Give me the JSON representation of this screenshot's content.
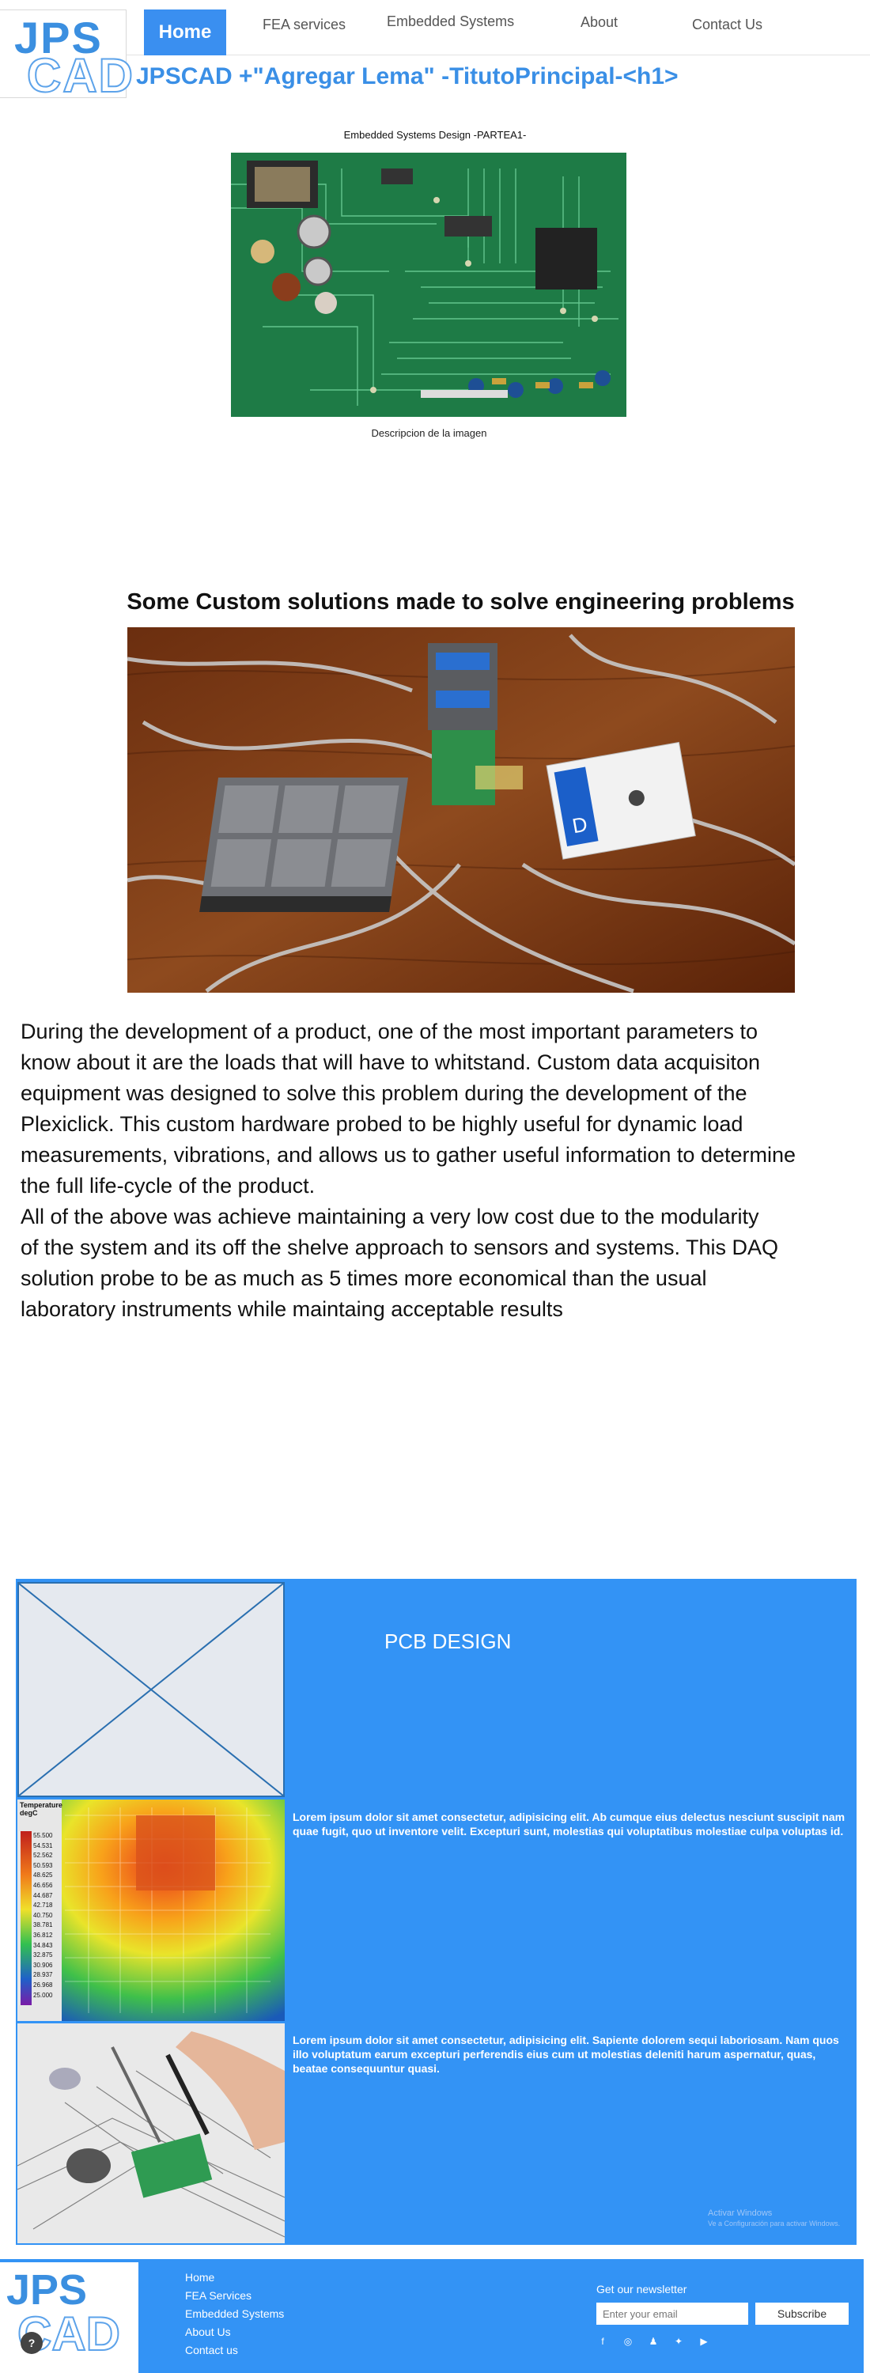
{
  "header": {
    "logo_top": "JPS",
    "logo_bottom": "CAD",
    "nav": [
      "Home",
      "FEA services",
      "Embedded Systems",
      "About",
      "Contact Us"
    ],
    "site_title": "JPSCAD +\"Agregar Lema\" -TitutoPrincipal-<h1>"
  },
  "figure1": {
    "title": "Embedded Systems Design -PARTEA1-",
    "caption": "Descripcion de la imagen"
  },
  "section2": {
    "title": "Some Custom solutions made to solve engineering problems",
    "paragraph1": "During the development of a product, one of the most important parameters to\nknow about it are the loads that will have to whitstand. Custom data acquisiton\nequipment was designed to solve this problem during the development of the\nPlexiclick. This custom hardware probed to be highly useful for dynamic load\nmeasurements, vibrations, and allows us to gather useful information to determine\nthe full life-cycle of the product.",
    "paragraph2": "All of the above was achieve maintaining a very low cost due to the modularity\nof the system and its off the shelve approach to sensors and systems. This DAQ\nsolution probe to be as much as 5 times more economical than the usual\nlaboratory instruments while maintaing acceptable results"
  },
  "pcb_section": {
    "title": "PCB DESIGN",
    "text1": "Lorem ipsum dolor sit amet consectetur, adipisicing elit. Ab cumque eius delectus nesciunt suscipit nam quae fugit, quo ut inventore velit. Excepturi sunt, molestias qui voluptatibus molestiae culpa voluptas id.",
    "text2": "Lorem ipsum dolor sit amet consectetur, adipisicing elit. Sapiente dolorem sequi laboriosam. Nam quos illo voluptatum earum excepturi perferendis eius cum ut molestias deleniti harum aspernatur, quas, beatae consequuntur quasi.",
    "thermal_legend_title": "Temperature degC",
    "thermal_legend_values": [
      "55.500",
      "54.531",
      "52.562",
      "50.593",
      "48.625",
      "46.656",
      "44.687",
      "42.718",
      "40.750",
      "38.781",
      "36.812",
      "34.843",
      "32.875",
      "30.906",
      "28.937",
      "26.968",
      "25.000"
    ],
    "watermark_title": "Activar Windows",
    "watermark_sub": "Ve a Configuración para activar Windows."
  },
  "footer": {
    "logo_top": "JPS",
    "logo_bottom": "CAD",
    "help_glyph": "?",
    "links": [
      "Home",
      "FEA Services",
      "Embedded Systems",
      "About Us",
      "Contact us"
    ],
    "newsletter_label": "Get our newsletter",
    "email_placeholder": "Enter your email",
    "subscribe_label": "Subscribe",
    "social": [
      {
        "icon": "facebook-icon",
        "glyph": "f"
      },
      {
        "icon": "instagram-icon",
        "glyph": "◎"
      },
      {
        "icon": "snapchat-icon",
        "glyph": "♟"
      },
      {
        "icon": "twitter-icon",
        "glyph": "✦"
      },
      {
        "icon": "youtube-icon",
        "glyph": "▶"
      }
    ]
  },
  "colors": {
    "brand_blue": "#3393f5",
    "nav_active": "#3a8ff0",
    "title_blue": "#3a8fe6"
  }
}
